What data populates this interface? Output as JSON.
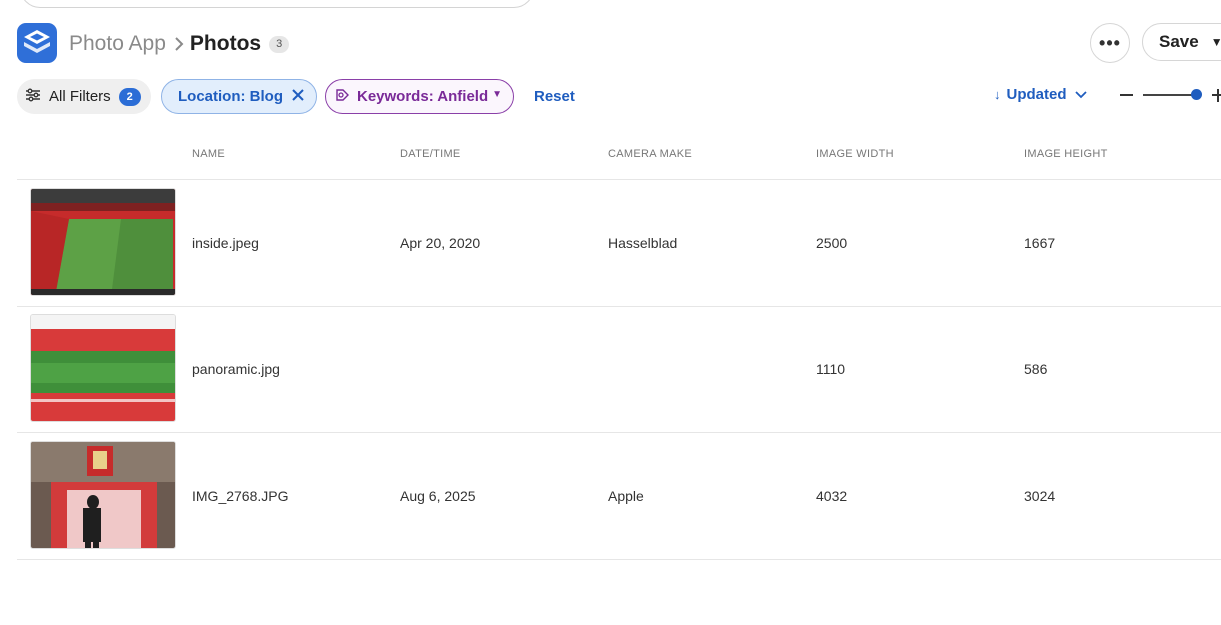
{
  "header": {
    "app_name": "Photo App",
    "current_page": "Photos",
    "item_count": "3",
    "save_label": "Save",
    "more_label": "•••"
  },
  "filters": {
    "all_filters_label": "All Filters",
    "all_filters_count": "2",
    "location_chip": "Location: Blog",
    "keywords_chip": "Keywords: Anfield",
    "reset_label": "Reset"
  },
  "sort": {
    "label": "Updated",
    "direction_icon": "arrow-down"
  },
  "zoom": {
    "level": 1.0
  },
  "table": {
    "columns": [
      "NAME",
      "DATE/TIME",
      "CAMERA MAKE",
      "IMAGE WIDTH",
      "IMAGE HEIGHT"
    ],
    "rows": [
      {
        "name": "inside.jpeg",
        "datetime": "Apr 20, 2020",
        "camera_make": "Hasselblad",
        "width": "2500",
        "height": "1667",
        "thumb": "stadium-interior"
      },
      {
        "name": "panoramic.jpg",
        "datetime": "",
        "camera_make": "",
        "width": "1110",
        "height": "586",
        "thumb": "stadium-panorama"
      },
      {
        "name": "IMG_2768.JPG",
        "datetime": "Aug 6, 2025",
        "camera_make": "Apple",
        "width": "4032",
        "height": "3024",
        "thumb": "players-tunnel"
      }
    ]
  },
  "colors": {
    "accent": "#1f5dbf",
    "keyword_chip": "#7a2a98",
    "location_chip_bg": "#e2eefc"
  }
}
